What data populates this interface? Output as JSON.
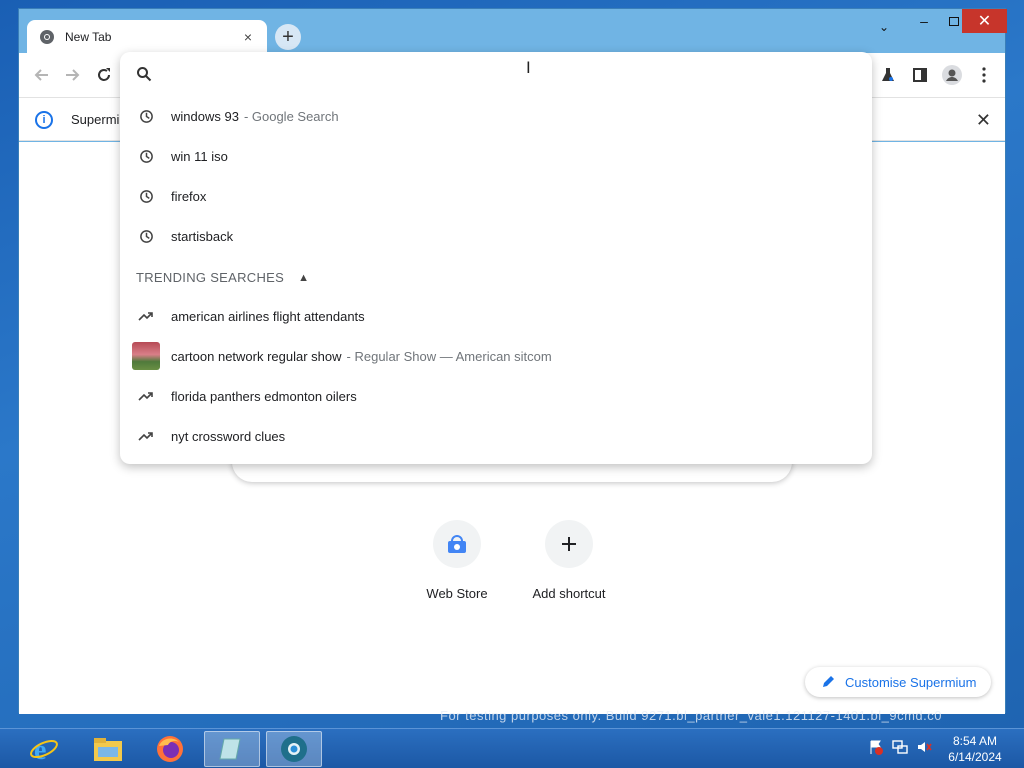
{
  "tab": {
    "title": "New Tab",
    "close": "×"
  },
  "newtab": {
    "label": "+"
  },
  "window_controls": {
    "minimize": "–",
    "close": "✕",
    "tab_search": "⌄"
  },
  "infobar": {
    "text": "Supermiu",
    "close": "✕"
  },
  "omnibox": {
    "query": "",
    "cursor": "I",
    "history": [
      {
        "text": "windows 93",
        "suffix": "- Google Search",
        "icon": "history-icon"
      },
      {
        "text": "win 11 iso",
        "suffix": "",
        "icon": "history-icon"
      },
      {
        "text": "firefox",
        "suffix": "",
        "icon": "history-icon"
      },
      {
        "text": "startisback",
        "suffix": "",
        "icon": "history-icon"
      }
    ],
    "trending_header": "TRENDING SEARCHES",
    "trending": [
      {
        "text": "american airlines flight attendants",
        "suffix": "",
        "icon": "trending-icon"
      },
      {
        "text": "cartoon network regular show",
        "suffix": "- Regular Show — American sitcom",
        "icon": "thumbnail"
      },
      {
        "text": "florida panthers edmonton oilers",
        "suffix": "",
        "icon": "trending-icon"
      },
      {
        "text": "nyt crossword clues",
        "suffix": "",
        "icon": "trending-icon"
      }
    ]
  },
  "shortcuts": [
    {
      "label": "Web Store",
      "icon": "web-store-icon"
    },
    {
      "label": "Add shortcut",
      "icon": "plus-icon"
    }
  ],
  "customise": {
    "label": "Customise Supermium"
  },
  "watermark": "For testing purposes only. Build 9271.bl_partner_vale1.121127-1401.bl_9cmd.c0",
  "taskbar": {
    "items": [
      "ie-icon",
      "file-explorer-icon",
      "firefox-icon",
      "app-icon",
      "supermium-icon"
    ],
    "clock_time": "8:54 AM",
    "clock_date": "6/14/2024"
  },
  "colors": {
    "accent": "#1a73e8",
    "close_red": "#c7352b",
    "titlebar": "#70b4e4",
    "taskbar": "#1c58a5"
  }
}
